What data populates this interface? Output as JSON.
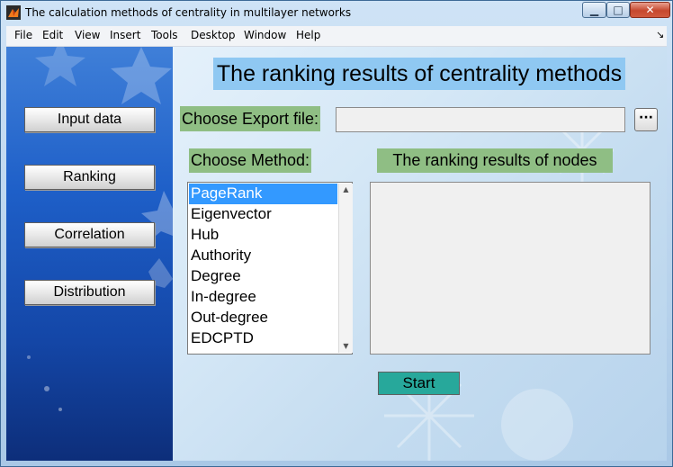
{
  "window": {
    "title": "The calculation methods of centrality in multilayer networks",
    "controls": {
      "minimize": "▁",
      "maximize": "□",
      "close": "✕"
    }
  },
  "menubar": {
    "items": [
      "File",
      "Edit",
      "View",
      "Insert",
      "Tools",
      "Desktop",
      "Window",
      "Help"
    ],
    "overflow_arrow": "↘"
  },
  "sidebar": {
    "buttons": [
      "Input data",
      "Ranking",
      "Correlation",
      "Distribution"
    ]
  },
  "main": {
    "heading": "The ranking results of centrality methods",
    "export": {
      "label": "Choose Export file:",
      "value": "",
      "browse_label": "···"
    },
    "method": {
      "label": "Choose Method:",
      "options": [
        "PageRank",
        "Eigenvector",
        "Hub",
        "Authority",
        "Degree",
        "In-degree",
        "Out-degree",
        "EDCPTD"
      ],
      "selected": "PageRank"
    },
    "results": {
      "label": "The ranking results of nodes",
      "value": ""
    },
    "start_label": "Start"
  },
  "colors": {
    "label_green": "#8fbe84",
    "heading_blue": "#8fc8f2",
    "start_teal": "#27a89b",
    "selection_blue": "#3399ff"
  }
}
